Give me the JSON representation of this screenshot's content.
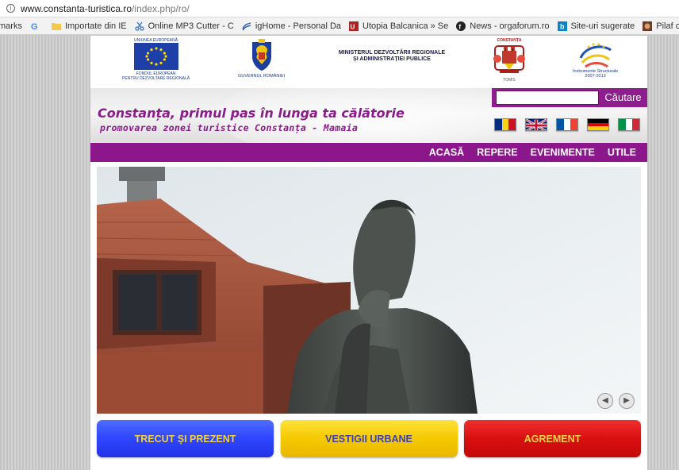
{
  "browser": {
    "url_host": "www.constanta-turistica.ro",
    "url_path": "/index.php/ro/",
    "bookmarks": [
      {
        "label": "marks",
        "icon": "none"
      },
      {
        "label": "",
        "icon": "google-icon"
      },
      {
        "label": "Importate din IE",
        "icon": "folder-icon"
      },
      {
        "label": "Online MP3 Cutter - C",
        "icon": "scissors-icon"
      },
      {
        "label": "igHome - Personal Da",
        "icon": "ighome-icon"
      },
      {
        "label": "Utopia Balcanica » Se",
        "icon": "utopia-icon"
      },
      {
        "label": "News - orgaforum.ro",
        "icon": "news-icon"
      },
      {
        "label": "Site-uri sugerate",
        "icon": "bing-icon"
      },
      {
        "label": "Pilaf cu dovlecei ~ Bu",
        "icon": "recipe-icon"
      }
    ]
  },
  "logos": {
    "eu_top": "UNIUNEA EUROPEANĂ",
    "eu_bottom_1": "FONDUL EUROPEAN",
    "eu_bottom_2": "PENTRU DEZVOLTARE REGIONALĂ",
    "gov": "GUVERNUL ROMÂNIEI",
    "ministry_1": "MINISTERUL DEZVOLTĂRII REGIONALE",
    "ministry_2": "ȘI ADMINISTRAȚIEI PUBLICE",
    "city_top": "CONSTANȚA",
    "city_bottom": "TOMIS",
    "struct_1": "Instrumente Structurale",
    "struct_2": "2007-2013"
  },
  "header": {
    "tagline": "Constanța, primul pas în lunga ta călătorie",
    "subtagline": "promovarea zonei turistice Constanța - Mamaia"
  },
  "search": {
    "value": "",
    "button": "Căutare"
  },
  "flags": [
    {
      "name": "flag-romania",
      "stripes": [
        "#002b7f",
        "#fcd116",
        "#ce1126"
      ],
      "dir": "v"
    },
    {
      "name": "flag-uk",
      "stripes": [],
      "dir": "uk"
    },
    {
      "name": "flag-france",
      "stripes": [
        "#0055a4",
        "#ffffff",
        "#ef4135"
      ],
      "dir": "v"
    },
    {
      "name": "flag-germany",
      "stripes": [
        "#000000",
        "#dd0000",
        "#ffce00"
      ],
      "dir": "h"
    },
    {
      "name": "flag-italy",
      "stripes": [
        "#009246",
        "#ffffff",
        "#ce2b37"
      ],
      "dir": "v"
    }
  ],
  "nav": [
    {
      "label": "ACASĂ"
    },
    {
      "label": "REPERE"
    },
    {
      "label": "EVENIMENTE"
    },
    {
      "label": "UTILE"
    }
  ],
  "hero": {
    "prev": "◀",
    "next": "▶"
  },
  "categories": [
    {
      "label": "TRECUT ȘI PREZENT",
      "style": "blue"
    },
    {
      "label": "VESTIGII URBANE",
      "style": "yellow"
    },
    {
      "label": "AGREMENT",
      "style": "red"
    }
  ],
  "colors": {
    "brand_purple": "#8c178c",
    "accent_blue": "#2f45ff",
    "accent_yellow": "#f5c900",
    "accent_red": "#d90f0f"
  }
}
